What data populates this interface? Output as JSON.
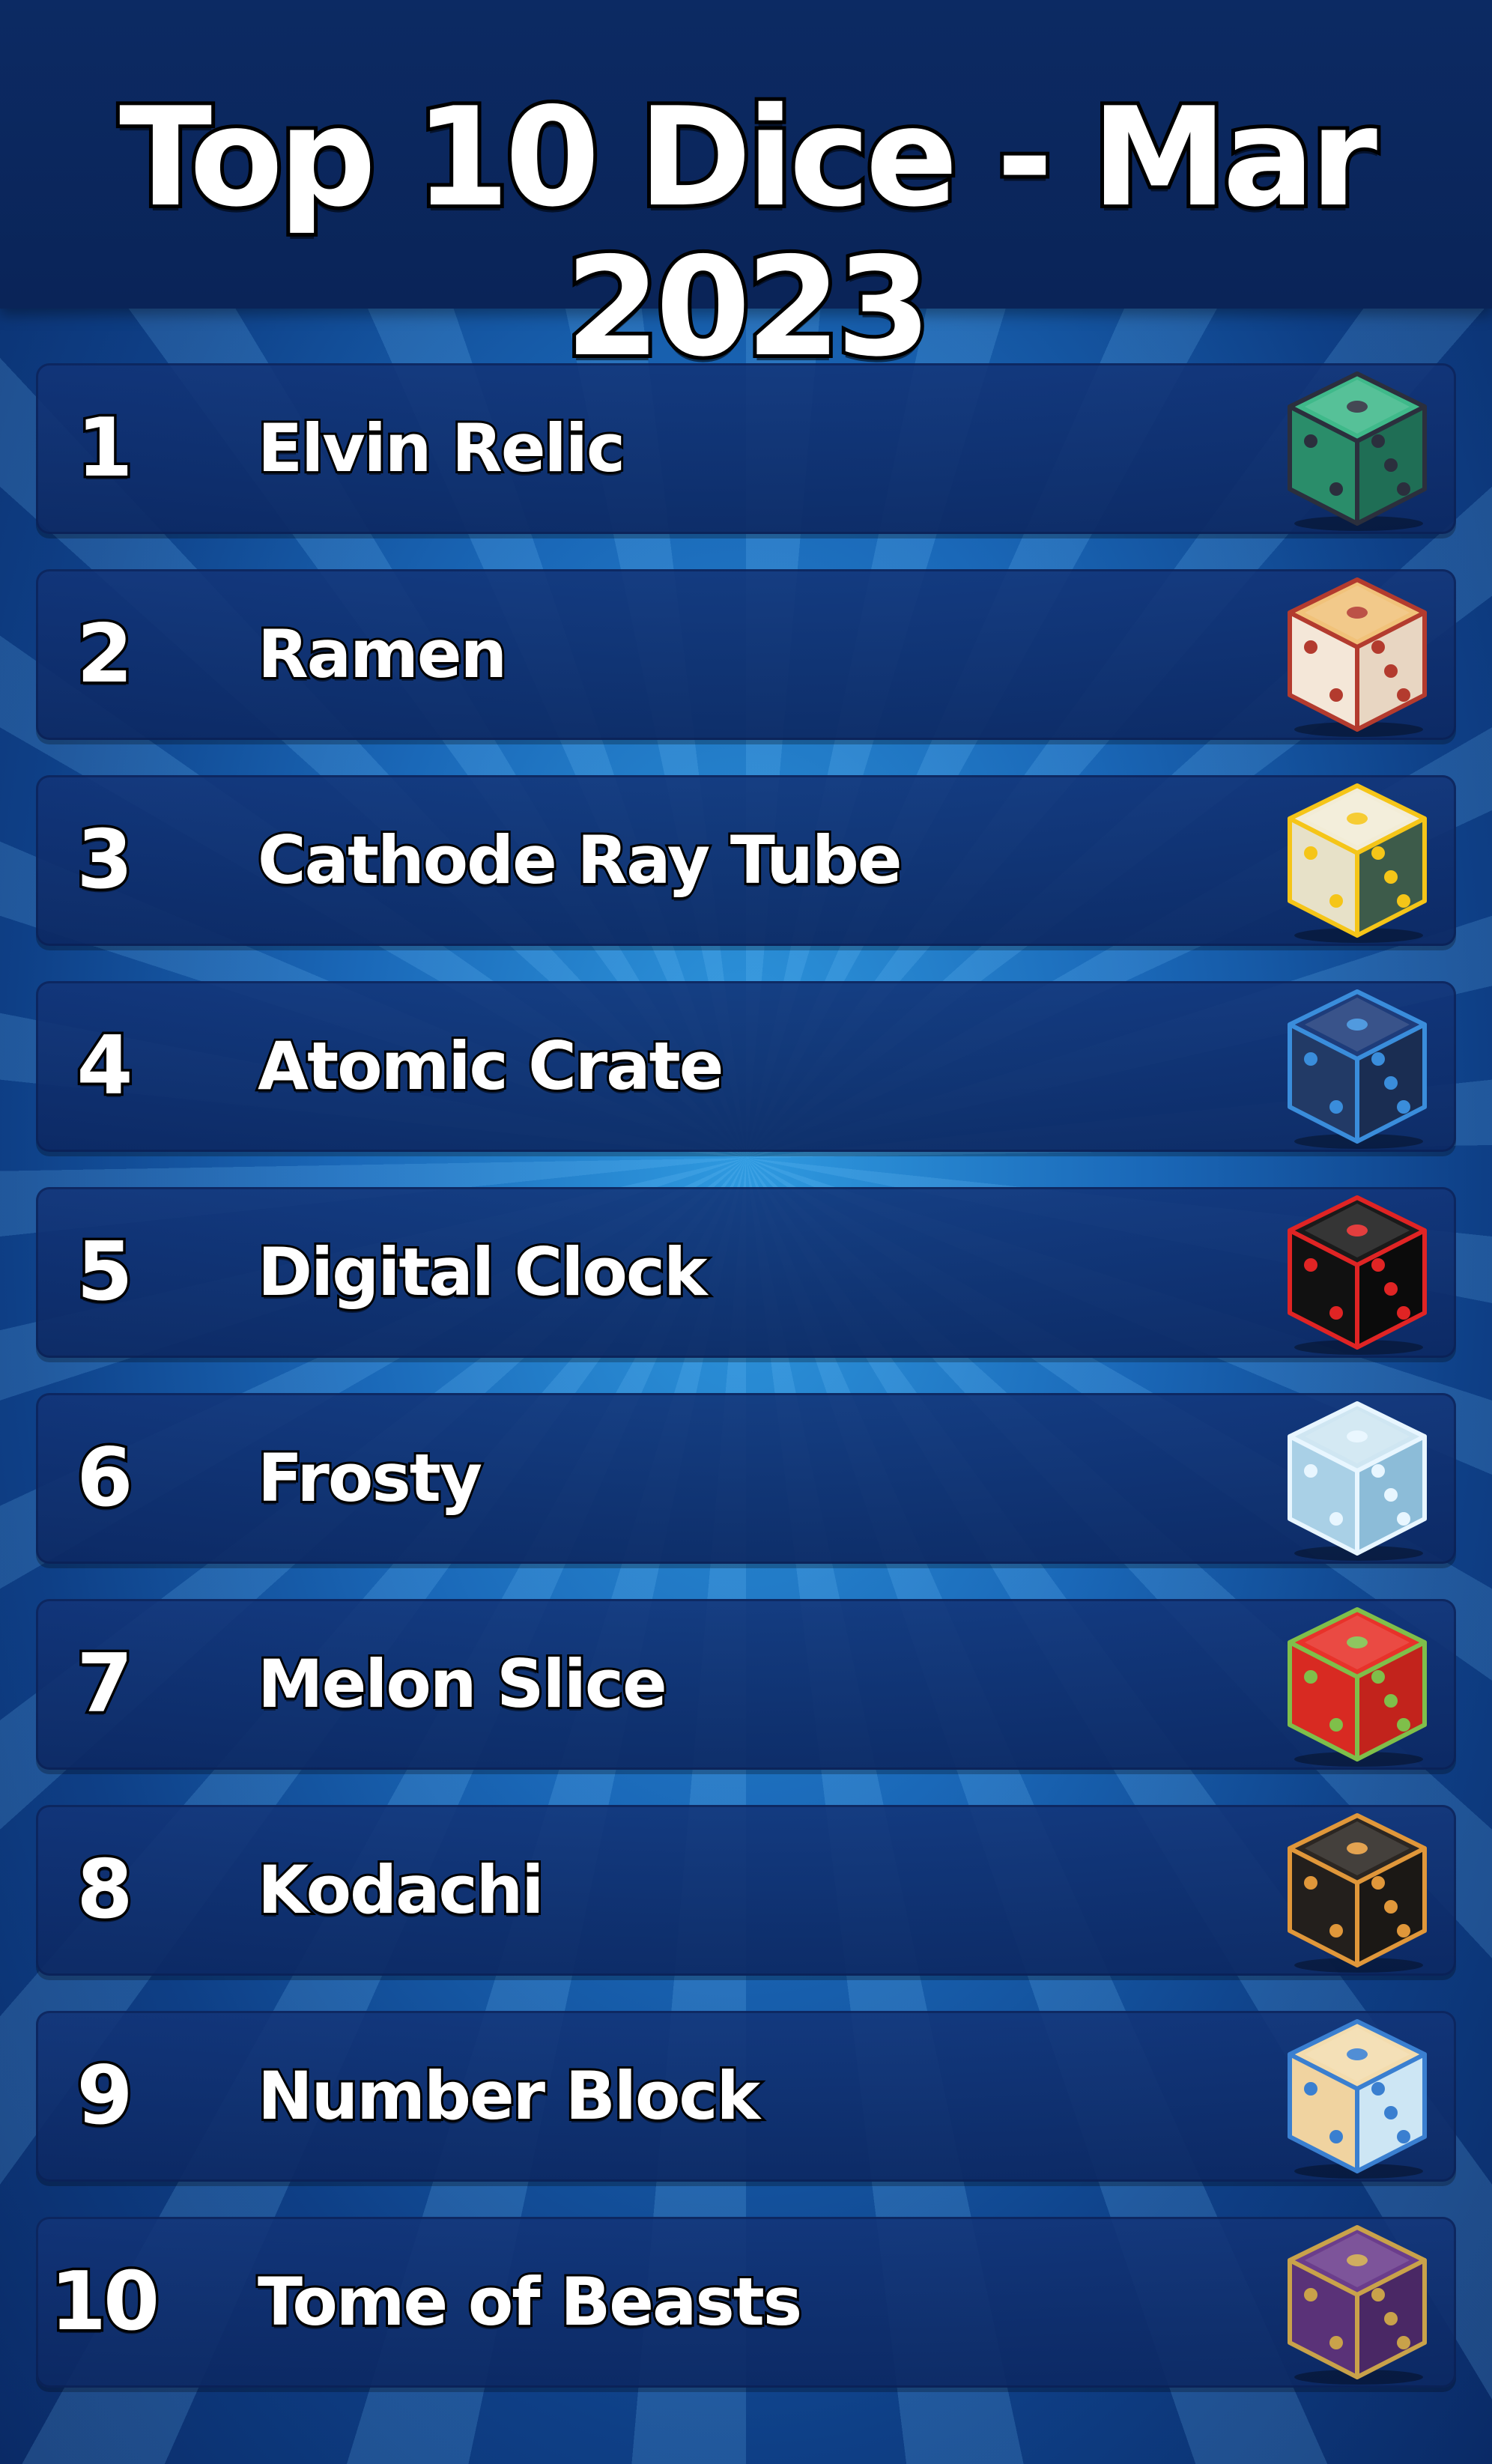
{
  "title": "Top 10 Dice - Mar 2023",
  "dice": [
    {
      "rank": "1",
      "name": "Elvin Relic",
      "icon": "elvin-relic-dice-icon",
      "top": "#3fb98a",
      "left": "#2a8d6a",
      "right": "#1f6e55",
      "trim": "#2b2f3d"
    },
    {
      "rank": "2",
      "name": "Ramen",
      "icon": "ramen-dice-icon",
      "top": "#f1c27a",
      "left": "#f4e7d8",
      "right": "#e8d6c2",
      "trim": "#b33b2e"
    },
    {
      "rank": "3",
      "name": "Cathode Ray Tube",
      "icon": "cathode-ray-tube-dice-icon",
      "top": "#f2ecd6",
      "left": "#e7e1c8",
      "right": "#3d5b4a",
      "trim": "#f5c518"
    },
    {
      "rank": "4",
      "name": "Atomic Crate",
      "icon": "atomic-crate-dice-icon",
      "top": "#1e3c7a",
      "left": "#223a66",
      "right": "#1a2d52",
      "trim": "#3a8ddb"
    },
    {
      "rank": "5",
      "name": "Digital Clock",
      "icon": "digital-clock-dice-icon",
      "top": "#1a1a1a",
      "left": "#111111",
      "right": "#0b0b0b",
      "trim": "#e02424"
    },
    {
      "rank": "6",
      "name": "Frosty",
      "icon": "frosty-dice-icon",
      "top": "#cfe6f2",
      "left": "#a9d0e6",
      "right": "#8cbcd8",
      "trim": "#e8f6ff"
    },
    {
      "rank": "7",
      "name": "Melon Slice",
      "icon": "melon-slice-dice-icon",
      "top": "#e8322a",
      "left": "#d82a22",
      "right": "#c2231c",
      "trim": "#7fbf4a"
    },
    {
      "rank": "8",
      "name": "Kodachi",
      "icon": "kodachi-dice-icon",
      "top": "#2b2622",
      "left": "#231f1c",
      "right": "#1b1815",
      "trim": "#e0973a"
    },
    {
      "rank": "9",
      "name": "Number Block",
      "icon": "number-block-dice-icon",
      "top": "#f3dcae",
      "left": "#f0d3a0",
      "right": "#cde6f4",
      "trim": "#3a7fd0"
    },
    {
      "rank": "10",
      "name": "Tome of Beasts",
      "icon": "tome-of-beasts-dice-icon",
      "top": "#6b3d8c",
      "left": "#5a3278",
      "right": "#4a2865",
      "trim": "#c9a24a"
    }
  ]
}
